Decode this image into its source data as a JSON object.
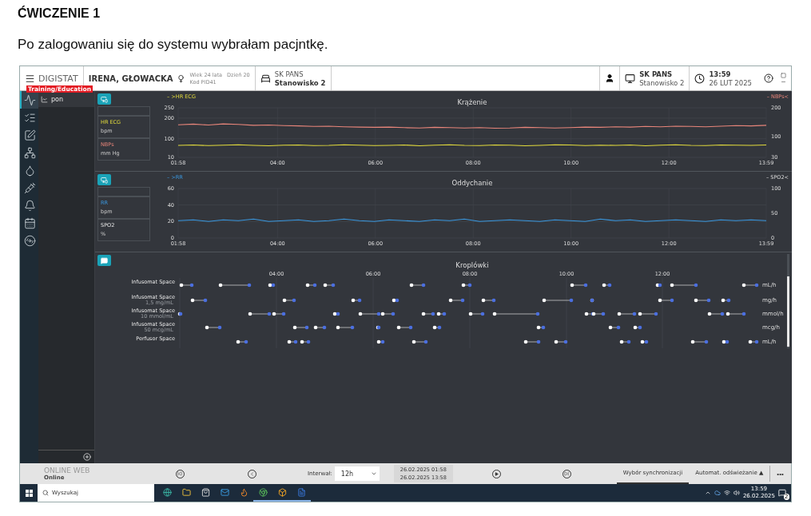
{
  "document": {
    "heading": "ĆWICZENIE 1",
    "paragraph": "Po zalogowaniu się do systemu wybrałam pacjntkę."
  },
  "header": {
    "app_name": "DIGISTAT",
    "badge": "Training/Education",
    "patient_name": "IRENA, GŁOWACKA",
    "age": "Wiek 24 lata",
    "day": "Dzień 20",
    "code": "Kod PID41",
    "ward": "SK PANS",
    "bed": "Stanowisko 2",
    "station_ward": "SK PANS",
    "station": "Stanowisko 2",
    "time": "13:59",
    "date": "26 LUT 2025"
  },
  "nav": [
    {
      "kind": "vitals",
      "selected": true
    },
    {
      "kind": "checklist",
      "selected": false
    },
    {
      "kind": "edit",
      "selected": false
    },
    {
      "kind": "hierarchy",
      "selected": false
    },
    {
      "kind": "drop",
      "selected": false
    },
    {
      "kind": "syringe",
      "selected": false
    },
    {
      "kind": "bell",
      "selected": false
    },
    {
      "kind": "calendar",
      "selected": false
    },
    {
      "kind": "disc",
      "selected": false
    }
  ],
  "panel": {
    "items": [
      {
        "label": "pon",
        "selected": true
      }
    ]
  },
  "charts": [
    {
      "left_tag": "– >HR ECG",
      "right_tag": "– NBPs<",
      "units": [
        "bpm",
        "mm Hg"
      ],
      "chart_data": {
        "type": "line",
        "title": "Krążenie",
        "grid": true,
        "x": [
          1.97,
          2.28,
          2.59,
          2.89,
          3.2,
          3.51,
          3.82,
          4.13,
          4.43,
          4.74,
          5.05,
          5.36,
          5.67,
          5.98,
          6.28,
          6.59,
          6.9,
          7.21,
          7.52,
          7.82,
          8.13,
          8.44,
          8.75,
          9.06,
          9.36,
          9.67,
          9.98,
          10.29,
          10.6,
          10.91,
          11.21,
          11.52,
          11.83,
          12.14,
          12.45,
          12.75,
          13.06,
          13.37,
          13.68,
          13.99
        ],
        "xlim": [
          1.97,
          13.99
        ],
        "ylim": [
          10,
          250
        ],
        "yticks": [
          10,
          100,
          200,
          250
        ],
        "y2lim": [
          30,
          200
        ],
        "y2ticks": [
          30,
          100,
          200
        ],
        "xticks": [
          {
            "value": 1.97,
            "label": "01:58"
          },
          {
            "value": 4,
            "label": "04:00"
          },
          {
            "value": 6,
            "label": "06:00"
          },
          {
            "value": 8,
            "label": "08:00"
          },
          {
            "value": 10,
            "label": "10:00"
          },
          {
            "value": 12,
            "label": "12:00"
          },
          {
            "value": 13.99,
            "label": "13:59"
          }
        ],
        "series": [
          {
            "name": "HR ECG",
            "color": "#e3dc3c",
            "values": [
              68,
              70,
              67,
              69,
              71,
              68,
              66,
              69,
              70,
              67,
              68,
              71,
              69,
              67,
              68,
              70,
              66,
              69,
              71,
              68,
              67,
              70,
              69,
              66,
              68,
              71,
              70,
              67,
              69,
              68,
              70,
              66,
              69,
              71,
              68,
              67,
              70,
              69,
              68,
              70
            ]
          },
          {
            "name": "NBPs",
            "color": "#e8857a",
            "axis": "y2",
            "values": [
              142,
              144,
              141,
              145,
              143,
              140,
              141,
              139,
              138,
              136,
              137,
              135,
              134,
              133,
              134,
              132,
              131,
              133,
              132,
              131,
              132,
              130,
              131,
              133,
              132,
              131,
              132,
              134,
              133,
              135,
              134,
              136,
              135,
              137,
              136,
              135,
              137,
              139,
              138,
              140
            ]
          }
        ]
      }
    },
    {
      "left_tag": "– >RR",
      "right_tag": "– SPO2<",
      "units": [
        "bpm",
        "%"
      ],
      "chart_data": {
        "type": "line",
        "title": "Oddychanie",
        "grid": true,
        "x": [
          1.97,
          2.28,
          2.59,
          2.89,
          3.2,
          3.51,
          3.82,
          4.13,
          4.43,
          4.74,
          5.05,
          5.36,
          5.67,
          5.98,
          6.28,
          6.59,
          6.9,
          7.21,
          7.52,
          7.82,
          8.13,
          8.44,
          8.75,
          9.06,
          9.36,
          9.67,
          9.98,
          10.29,
          10.6,
          10.91,
          11.21,
          11.52,
          11.83,
          12.14,
          12.45,
          12.75,
          13.06,
          13.37,
          13.68,
          13.99
        ],
        "xlim": [
          1.97,
          13.99
        ],
        "ylim": [
          0,
          60
        ],
        "yticks": [
          0,
          20,
          40,
          60
        ],
        "y2lim": [
          0,
          100
        ],
        "y2ticks": [
          0,
          50,
          100
        ],
        "xticks": [
          {
            "value": 1.97,
            "label": "01:58"
          },
          {
            "value": 4,
            "label": "04:00"
          },
          {
            "value": 6,
            "label": "06:00"
          },
          {
            "value": 8,
            "label": "08:00"
          },
          {
            "value": 10,
            "label": "10:00"
          },
          {
            "value": 12,
            "label": "12:00"
          },
          {
            "value": 13.99,
            "label": "13:59"
          }
        ],
        "series": [
          {
            "name": "RR",
            "color": "#3a98e0",
            "values": [
              21,
              22,
              20,
              22,
              21,
              23,
              20,
              21,
              22,
              20,
              21,
              23,
              21,
              20,
              22,
              21,
              20,
              22,
              21,
              23,
              20,
              21,
              22,
              21,
              20,
              22,
              21,
              20,
              23,
              21,
              22,
              20,
              21,
              22,
              21,
              20,
              22,
              21,
              22,
              21
            ]
          },
          {
            "name": "SPO2",
            "axis": "y2",
            "values": [
              null,
              null,
              null,
              null,
              null,
              null,
              null,
              null,
              null,
              null,
              null,
              null,
              null,
              null,
              null,
              null,
              null,
              null,
              null,
              null,
              null,
              null,
              null,
              null,
              null,
              null,
              null,
              null,
              null,
              null,
              null,
              null,
              null,
              null,
              null,
              null,
              null,
              null,
              null,
              null
            ]
          }
        ]
      }
    }
  ],
  "drips": {
    "title": "Kroplówki",
    "xticks": [
      "04:00",
      "06:00",
      "08:00",
      "10:00",
      "12:00"
    ],
    "rows": [
      {
        "label": "Infusomat Space",
        "unit": "mL/h"
      },
      {
        "label": "Infusomat Space",
        "concentration": "1,5 mg/mL",
        "unit": "mg/h"
      },
      {
        "label": "Infusomat Space",
        "concentration": "10 mmol/mL",
        "unit": "mmol/h"
      },
      {
        "label": "Infusomat Space",
        "concentration": "50 mcg/mL",
        "unit": "mcg/h"
      },
      {
        "label": "Perfusor Space",
        "unit": "mL/h"
      }
    ]
  },
  "bottom_bar": {
    "source": "ONLINE WEB",
    "status": "Online",
    "interval_label": "Interwał:",
    "interval": "12h",
    "range_from": "26.02.2025 01:58",
    "range_to": "26.02.2025 13:58",
    "tabs": [
      {
        "label": "Wybór synchronizacji",
        "selected": true
      },
      {
        "label": "Automat. odświeżanie ▲",
        "selected": false
      }
    ],
    "more": "•••"
  },
  "taskbar": {
    "search_placeholder": "Wyszukaj",
    "apps": [
      {
        "kind": "edge",
        "running": false
      },
      {
        "kind": "folder",
        "running": false
      },
      {
        "kind": "store",
        "running": false
      },
      {
        "kind": "mail",
        "running": false
      },
      {
        "kind": "firefox",
        "running": false
      },
      {
        "kind": "chrome",
        "running": true
      },
      {
        "kind": "app",
        "running": true
      },
      {
        "kind": "word",
        "running": true
      }
    ],
    "time": "13:59",
    "date": "26.02.2025",
    "notifications": "2"
  }
}
